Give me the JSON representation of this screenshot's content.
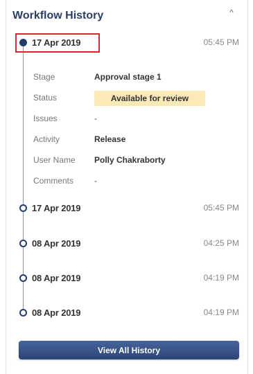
{
  "header": {
    "title": "Workflow History",
    "collapse_icon": "chevron-up-icon",
    "collapse_glyph": "^"
  },
  "entries": [
    {
      "date": "17 Apr 2019",
      "time": "05:45 PM",
      "expanded": true,
      "highlighted": true
    },
    {
      "date": "17 Apr 2019",
      "time": "05:45 PM",
      "expanded": false
    },
    {
      "date": "08 Apr 2019",
      "time": "04:25 PM",
      "expanded": false
    },
    {
      "date": "08 Apr 2019",
      "time": "04:19 PM",
      "expanded": false
    },
    {
      "date": "08 Apr 2019",
      "time": "04:19 PM",
      "expanded": false
    }
  ],
  "details": {
    "stage_label": "Stage",
    "stage_value": "Approval stage 1",
    "status_label": "Status",
    "status_value": "Available for review",
    "issues_label": "Issues",
    "issues_value": "-",
    "activity_label": "Activity",
    "activity_value": "Release",
    "user_label": "User Name",
    "user_value": "Polly Chakraborty",
    "comments_label": "Comments",
    "comments_value": "-"
  },
  "footer": {
    "view_all_label": "View All History"
  },
  "colors": {
    "title": "#2b3f63",
    "timeline_node": "#243b6b",
    "status_badge_bg": "#fbe9b7",
    "highlight_border": "#d8262e",
    "button_bg": "#2c4576"
  }
}
